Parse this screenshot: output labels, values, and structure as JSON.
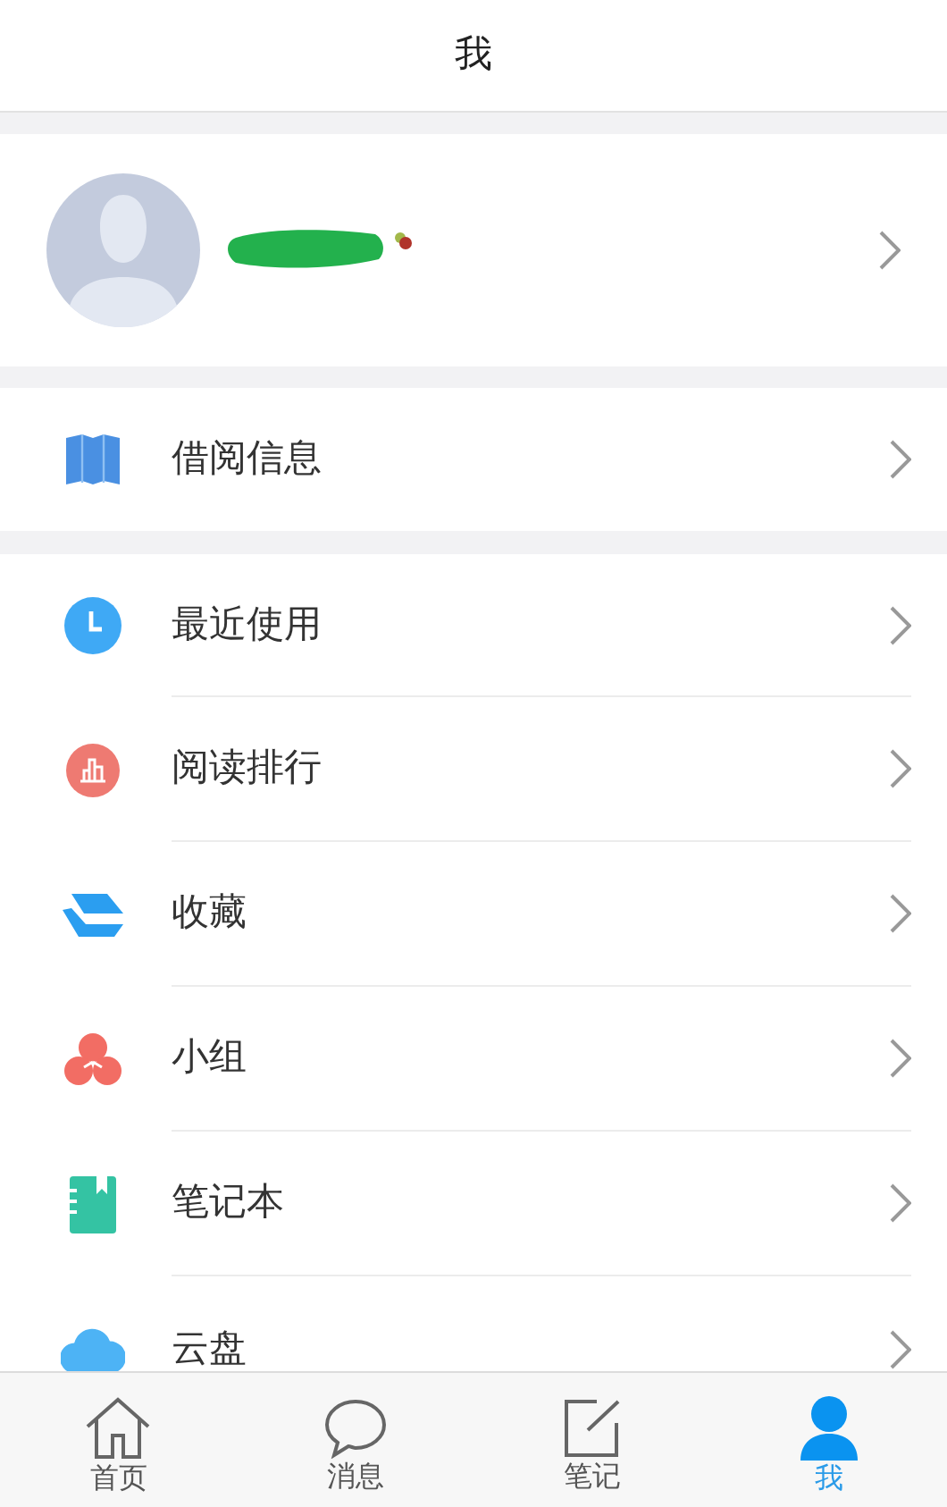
{
  "header": {
    "title": "我"
  },
  "profile": {
    "kind": "redacted"
  },
  "borrow": {
    "label": "借阅信息",
    "kind": "book"
  },
  "menu": [
    {
      "label": "最近使用",
      "kind": "clock"
    },
    {
      "label": "阅读排行",
      "kind": "chart"
    },
    {
      "label": "收藏",
      "kind": "layers"
    },
    {
      "label": "小组",
      "kind": "group"
    },
    {
      "label": "笔记本",
      "kind": "notebook"
    },
    {
      "label": "云盘",
      "kind": "cloud"
    }
  ],
  "tabs": [
    {
      "label": "首页",
      "kind": "home",
      "selected": false
    },
    {
      "label": "消息",
      "kind": "chat",
      "selected": false
    },
    {
      "label": "笔记",
      "kind": "note",
      "selected": false
    },
    {
      "label": "我",
      "kind": "person",
      "selected": true
    }
  ]
}
